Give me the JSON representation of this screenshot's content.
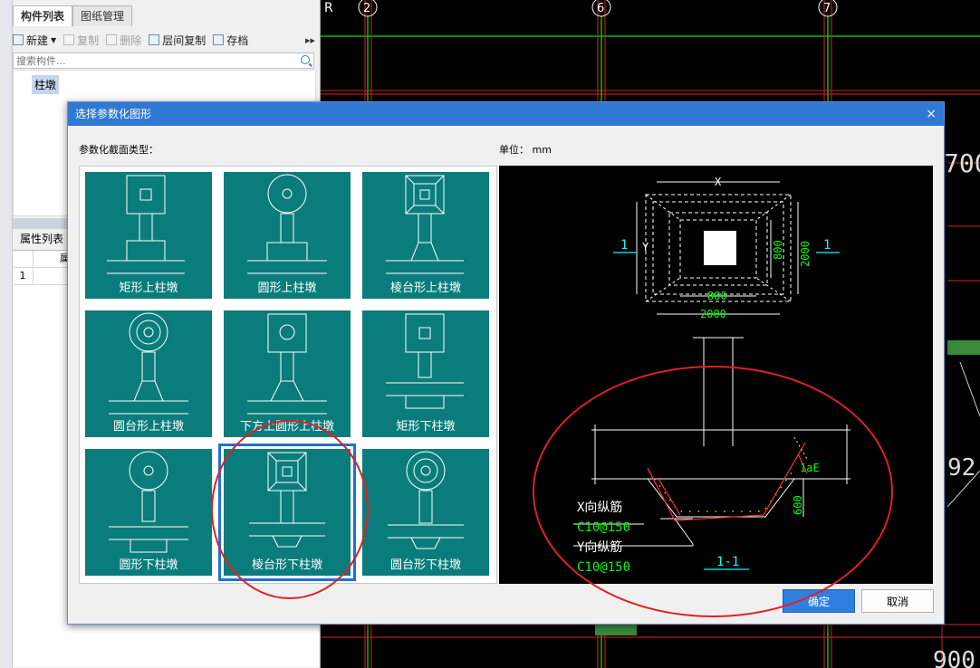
{
  "left_panel": {
    "tabs": [
      "构件列表",
      "图纸管理"
    ],
    "toolbar": {
      "new": "新建",
      "copy": "复制",
      "delete": "删除",
      "floor_copy": "层间复制",
      "archive": "存档",
      "more": "▸▸"
    },
    "search_placeholder": "搜索构件...",
    "tree_item": "柱墩",
    "property_title": "属性列表",
    "property_col": "属",
    "property_row_num": "1"
  },
  "cad_grid": {
    "axis_labels": [
      "R",
      "2",
      "6",
      "7"
    ],
    "right_texts": [
      "700",
      "92",
      "900"
    ]
  },
  "dialog": {
    "title": "选择参数化图形",
    "close": "×",
    "section_label": "参数化截面类型：",
    "unit_label": "单位： mm",
    "shapes": [
      {
        "label": "矩形上柱墩",
        "icon": "rect-upper-pier-icon"
      },
      {
        "label": "圆形上柱墩",
        "icon": "circle-upper-pier-icon"
      },
      {
        "label": "棱台形上柱墩",
        "icon": "frustum-upper-pier-icon"
      },
      {
        "label": "圆台形上柱墩",
        "icon": "round-frustum-upper-pier-icon"
      },
      {
        "label": "下方上圆形上柱墩",
        "icon": "square-round-upper-pier-icon"
      },
      {
        "label": "矩形下柱墩",
        "icon": "rect-lower-pier-icon"
      },
      {
        "label": "圆形下柱墩",
        "icon": "circle-lower-pier-icon"
      },
      {
        "label": "棱台形下柱墩",
        "icon": "frustum-lower-pier-icon"
      },
      {
        "label": "圆台形下柱墩",
        "icon": "round-frustum-lower-pier-icon"
      }
    ],
    "selected_shape": "棱台形下柱墩",
    "preview": {
      "dim_x": "X",
      "dim_y": "Y",
      "dim_800_h": "800",
      "dim_2000_h": "2000",
      "dim_800_v": "800",
      "dim_2000_v": "2000",
      "section_mark": "1",
      "dim_lae": "1aE",
      "dim_600": "600",
      "x_rebar_label": "X向纵筋",
      "x_rebar_value": "C10@150",
      "y_rebar_label": "Y向纵筋",
      "y_rebar_value": "C10@150",
      "section_title": "1-1"
    },
    "ok": "确定",
    "cancel": "取消"
  },
  "colors": {
    "title_bar": "#2f79d4",
    "tile_bg": "#0a7c7c",
    "selection_border": "#1e70d8",
    "annotation_red": "#e02020",
    "cad_green": "#00ff00",
    "cad_cyan": "#00ffff",
    "cad_red": "#ff2020"
  }
}
